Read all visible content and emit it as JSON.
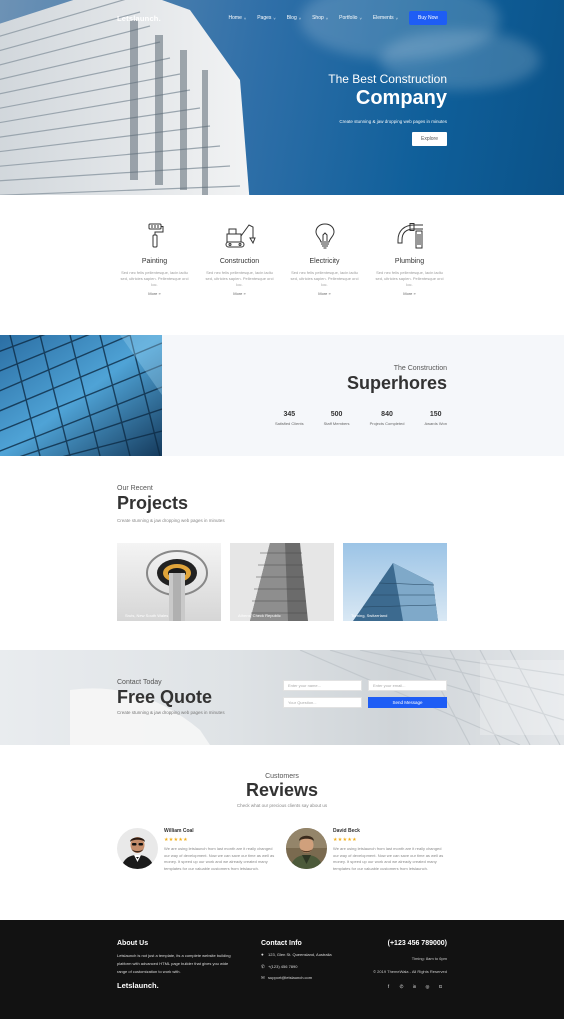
{
  "brand": {
    "logo": "Letslaunch.",
    "accent": "#1e5df5"
  },
  "nav": {
    "items": [
      {
        "label": "Home",
        "chevron": "˅"
      },
      {
        "label": "Pages",
        "chevron": "˅"
      },
      {
        "label": "Blog",
        "chevron": "˅"
      },
      {
        "label": "Shop",
        "chevron": "˅"
      },
      {
        "label": "Portfolio",
        "chevron": "˅"
      },
      {
        "label": "Elements",
        "chevron": "˅"
      }
    ],
    "cta": "Buy Now"
  },
  "hero": {
    "subtitle": "The Best Construction",
    "title": "Company",
    "description": "Create stunning & jaw dropping web pages in minutes",
    "button": "Explore"
  },
  "services": [
    {
      "icon": "paint-roller-icon",
      "title": "Painting",
      "text": "Sed nec felis pellentesque, lacin iadiu sed, ultricies sapien. Pellentesque orci loc.",
      "more": "More »"
    },
    {
      "icon": "excavator-icon",
      "title": "Construction",
      "text": "Sed nec felis pellentesque, lacin iadiu sed, ultricies sapien. Pellentesque orci loc.",
      "more": "More »"
    },
    {
      "icon": "light-bulb-icon",
      "title": "Electricity",
      "text": "Sed nec felis pellentesque, lacin iadiu sed, ultricies sapien. Pellentesque orci loc.",
      "more": "More »"
    },
    {
      "icon": "faucet-icon",
      "title": "Plumbing",
      "text": "Sed nec felis pellentesque, lacin iadiu sed, ultricies sapien. Pellentesque orci loc.",
      "more": "More »"
    }
  ],
  "stats": {
    "subtitle": "The Construction",
    "title": "Superhores",
    "items": [
      {
        "value": "345",
        "label": "Satisfied Clients"
      },
      {
        "value": "500",
        "label": "Staff Members"
      },
      {
        "value": "840",
        "label": "Projects Completed"
      },
      {
        "value": "150",
        "label": "Awards Won"
      }
    ]
  },
  "projects": {
    "subtitle": "Our Recent",
    "title": "Projects",
    "description": "Create stunning & jaw dropping web pages in minutes",
    "items": [
      {
        "caption": "Sruts, New South Wales"
      },
      {
        "caption": "Athens, Check Republic"
      },
      {
        "caption": "Turning, Switzerland"
      }
    ]
  },
  "quote": {
    "subtitle": "Contact Today",
    "title": "Free Quote",
    "description": "Create stunning & jaw dropping web pages in minutes",
    "name_placeholder": "Enter your name...",
    "email_placeholder": "Enter your email...",
    "question_placeholder": "Your Question...",
    "button": "Send Message"
  },
  "reviews": {
    "subtitle": "Customers",
    "title": "Reviews",
    "description": "Check what our precious clients say about us",
    "items": [
      {
        "name": "William Coal",
        "stars": "★★★★★",
        "text": "We are using letslaunch from last month are it really changed our way of development. Now we can save our time as well as money. It speed up our work and we already created many templates for our valuable customers from letslaunch."
      },
      {
        "name": "David Beck",
        "stars": "★★★★★",
        "text": "We are using letslaunch from last month are it really changed our way of development. Now we can save our time as well as money. It speed up our work and we already created many templates for our valuable customers from letslaunch."
      }
    ]
  },
  "footer": {
    "about_title": "About Us",
    "about_text": "Letslaunch is not just a template, its a complete website building platform with advanced HTML page builder that gives you wide range of customization to work with.",
    "logo": "Letslaunch.",
    "contact_title": "Contact Info",
    "address": "123, Glen St. Queensland, Australia",
    "phone": "+(123) 456 7890",
    "email": "support@letslaunch.com",
    "big_phone": "(+123 456 789000)",
    "timing": "Timing: 8am to 6pm",
    "copyright": "© 2019 ThemeWala - All Rights Reserved",
    "social": [
      "f",
      "✆",
      "in",
      "◎",
      "G"
    ]
  }
}
